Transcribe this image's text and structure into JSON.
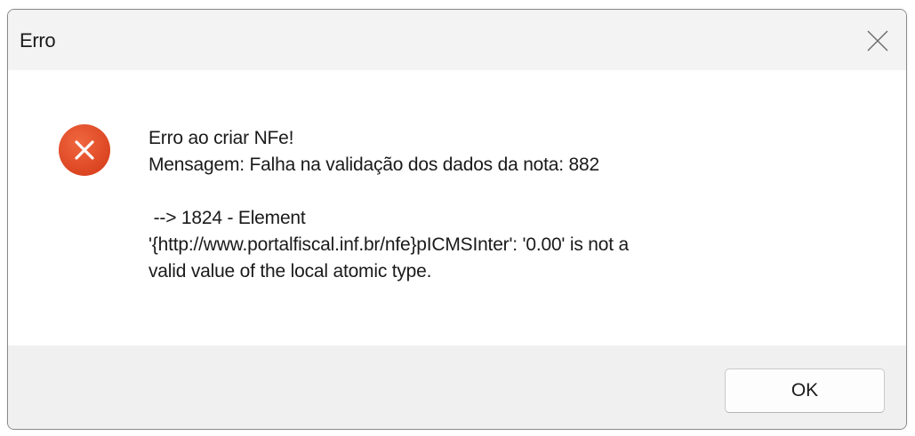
{
  "dialog": {
    "title": "Erro",
    "icon": "error-circle-icon",
    "message": {
      "line1": "Erro ao criar NFe!",
      "line2": "Mensagem: Falha na validação dos dados da nota: 882",
      "line3": " --> 1824 - Element",
      "line4": "'{http://www.portalfiscal.inf.br/nfe}pICMSInter': '0.00' is not a",
      "line5": "valid value of the local atomic type."
    },
    "ok_label": "OK"
  },
  "colors": {
    "error_icon": "#e34d2b",
    "titlebar_bg": "#f3f3f3",
    "footer_bg": "#f0f0f0"
  }
}
